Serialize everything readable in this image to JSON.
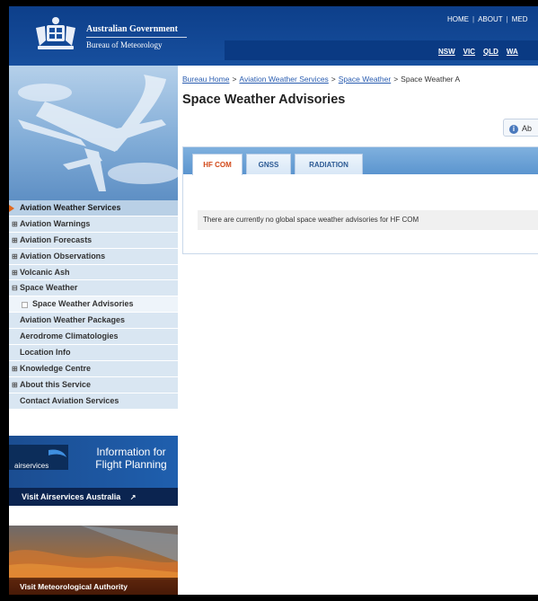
{
  "header": {
    "org_line1": "Australian Government",
    "org_line2": "Bureau of Meteorology",
    "top_links": [
      "HOME",
      "ABOUT",
      "MED"
    ],
    "state_links": [
      "NSW",
      "VIC",
      "QLD",
      "WA"
    ]
  },
  "sidebar": {
    "items": [
      {
        "label": "Aviation Weather Services",
        "kind": "top",
        "marker": "arrow"
      },
      {
        "label": "Aviation Warnings",
        "kind": "item",
        "marker": "+"
      },
      {
        "label": "Aviation Forecasts",
        "kind": "item",
        "marker": "+"
      },
      {
        "label": "Aviation Observations",
        "kind": "item",
        "marker": "+"
      },
      {
        "label": "Volcanic Ash",
        "kind": "item",
        "marker": "+"
      },
      {
        "label": "Space Weather",
        "kind": "item",
        "marker": "-"
      },
      {
        "label": "Space Weather Advisories",
        "kind": "sub",
        "marker": "square"
      },
      {
        "label": "Aviation Weather Packages",
        "kind": "item",
        "marker": ""
      },
      {
        "label": "Aerodrome Climatologies",
        "kind": "item",
        "marker": ""
      },
      {
        "label": "Location Info",
        "kind": "item",
        "marker": ""
      },
      {
        "label": "Knowledge Centre",
        "kind": "item",
        "marker": "+"
      },
      {
        "label": "About this Service",
        "kind": "item",
        "marker": "+"
      },
      {
        "label": "Contact Aviation Services",
        "kind": "item",
        "marker": ""
      }
    ]
  },
  "banners": {
    "airservices": {
      "logo_text": "airservices",
      "info_text": "Information for Flight Planning",
      "visit_text": "Visit Airservices Australia"
    },
    "met_authority": {
      "visit_text": "Visit Meteorological Authority"
    }
  },
  "breadcrumb": [
    "Bureau Home",
    "Aviation Weather Services",
    "Space Weather",
    "Space Weather A"
  ],
  "main": {
    "title": "Space Weather Advisories",
    "about_button": "Ab",
    "tabs": [
      {
        "label": "HF COM",
        "active": true
      },
      {
        "label": "GNSS",
        "active": false
      },
      {
        "label": "RADIATION",
        "active": false
      }
    ],
    "notice": "There are currently no global space weather advisories for HF COM"
  },
  "colors": {
    "header_blue": "#0d3f8a",
    "tab_bar_blue": "#5b95cf",
    "active_tab_text": "#d24a1a",
    "link_blue": "#2a5db0",
    "nav_bg": "#d9e6f2"
  }
}
